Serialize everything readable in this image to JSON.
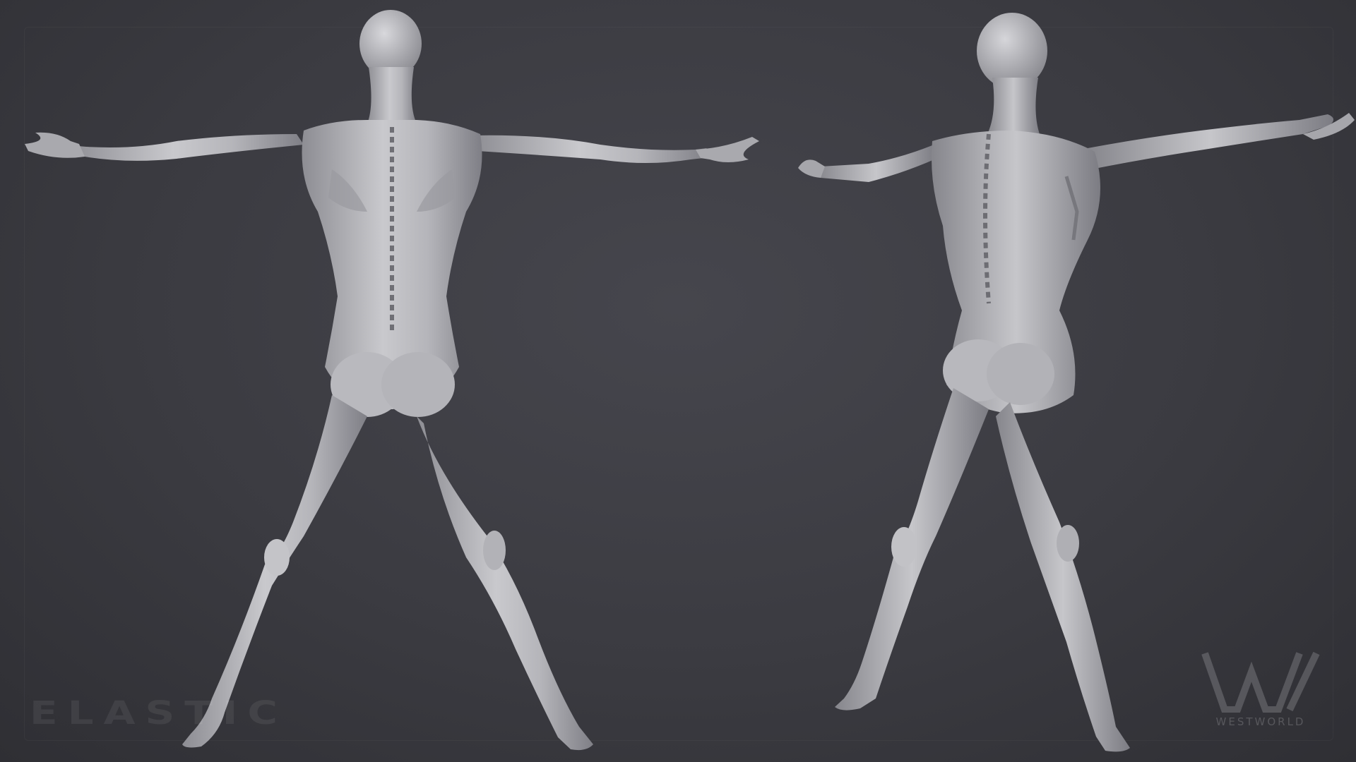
{
  "scene": {
    "background_color": "#3b3b41",
    "model_color": "#b8b8bc",
    "figures": [
      {
        "name": "posterior-view",
        "description_icon": "anatomy-figure-back-icon"
      },
      {
        "name": "three-quarter-posterior-view",
        "description_icon": "anatomy-figure-side-icon"
      }
    ]
  },
  "watermarks": {
    "left_text": "ELASTIC",
    "right_logo_icon": "westworld-w-logo-icon",
    "right_text": "WESTWORLD"
  }
}
